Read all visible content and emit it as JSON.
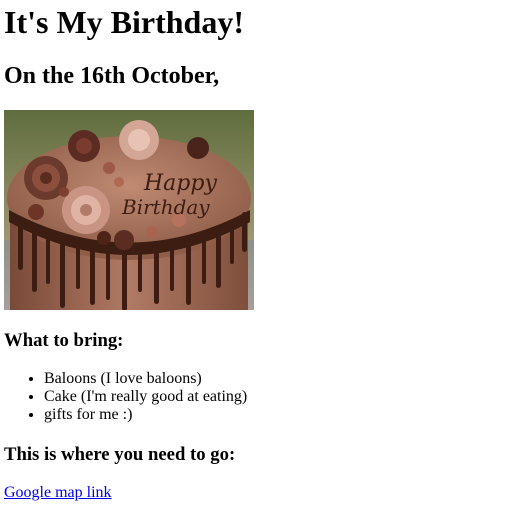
{
  "page": {
    "title": "It's My Birthday!",
    "date_heading": "On the 16th October,",
    "photo": {
      "icon": "birthday-cake-photo",
      "inscription": "Happy Birthday",
      "colors": {
        "frosting": "#a56f5c",
        "chocolate_drip": "#3d1d12",
        "background_top": "#6d7a4a",
        "background_bottom": "#b9a08a"
      }
    },
    "bring_heading": "What to bring:",
    "bring_items": [
      "Baloons (I love baloons)",
      "Cake (I'm really good at eating)",
      "gifts for me :)"
    ],
    "location_heading": "This is where you need to go:",
    "map_link_label": "Google map link",
    "link_color": "#0000ee"
  }
}
